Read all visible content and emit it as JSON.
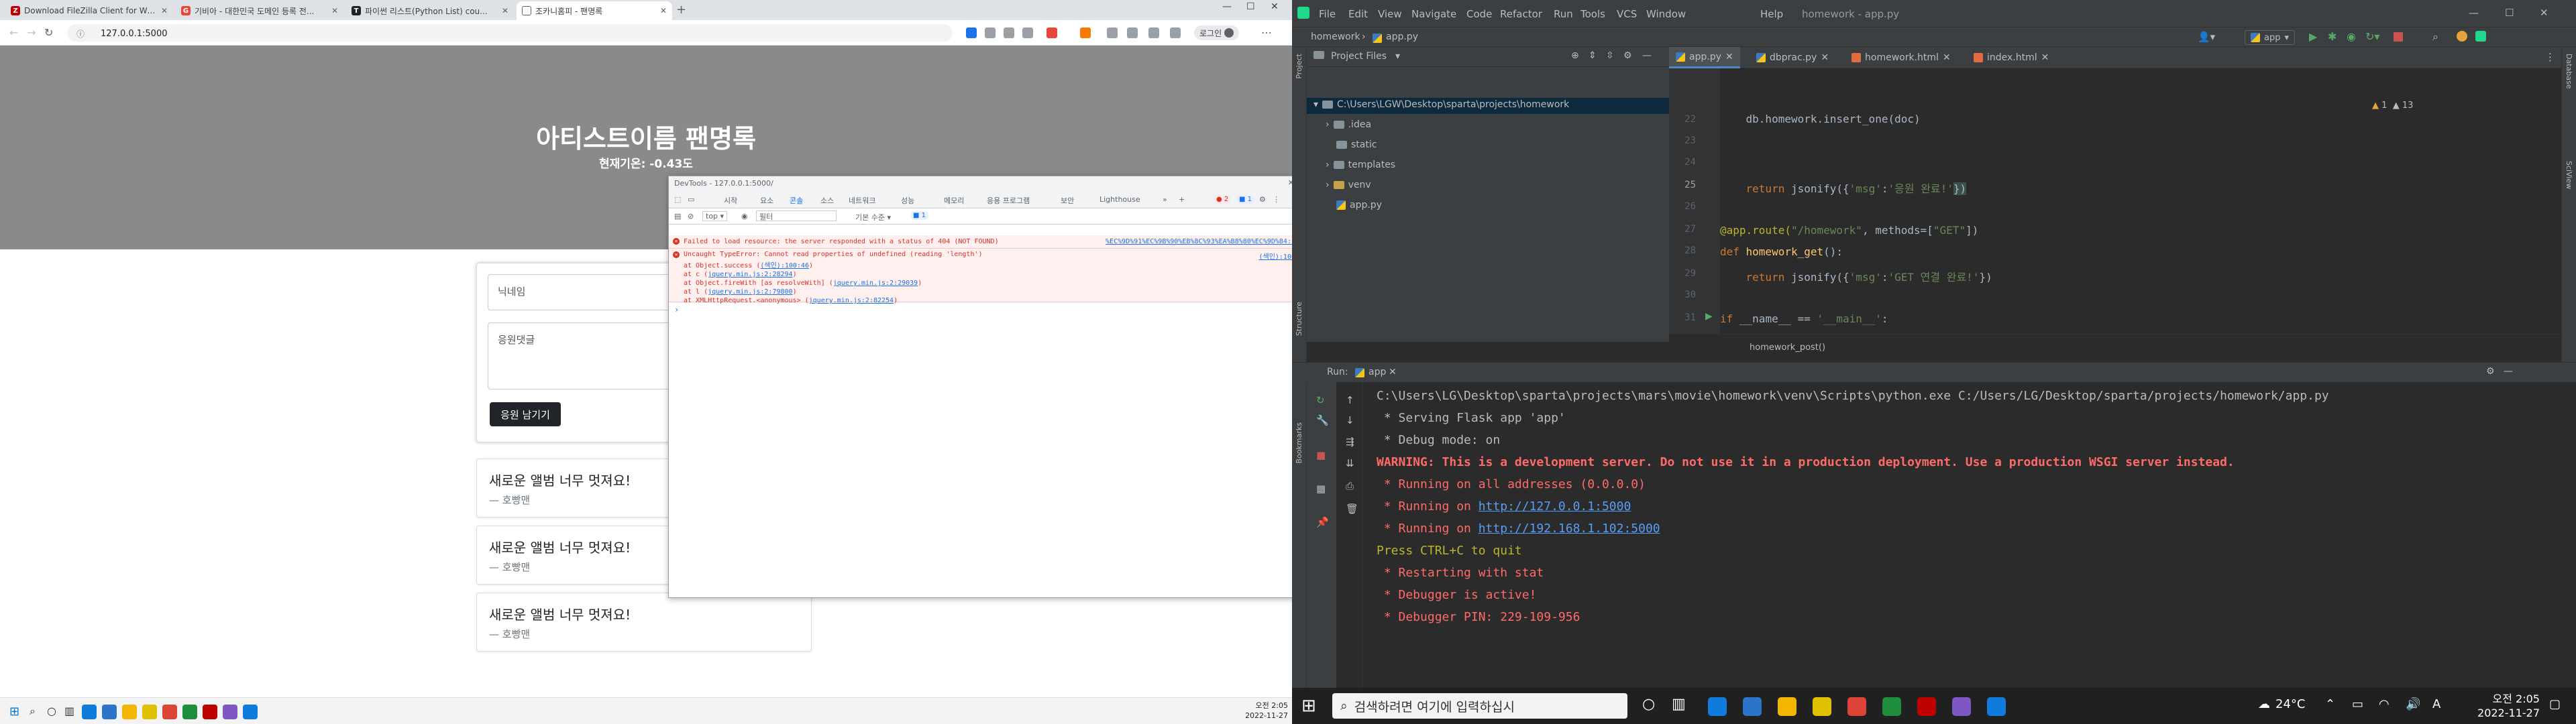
{
  "browser": {
    "tabs": [
      {
        "label": "Download FileZilla Client for Wi...",
        "fav_color": "#bf0000",
        "fav_char": "Z"
      },
      {
        "label": "기비아 - 대한민국 도메인 등록 전...",
        "fav_color": "#e8453c",
        "fav_char": "G"
      },
      {
        "label": "파이썬 리스트(Python List) cou...",
        "fav_color": "#222222",
        "fav_char": "T"
      },
      {
        "label": "조카니홈피 - 팬명록",
        "fav_color": "#5f6368",
        "fav_char": "□"
      }
    ],
    "url": "127.0.0.1:5000",
    "login_label": "로그인"
  },
  "page": {
    "title": "아티스트이름 팬명록",
    "temperature": "현재기온: -0.43도",
    "nickname_placeholder": "닉네임",
    "comment_placeholder": "응원댓글",
    "submit_label": "응원 남기기",
    "comments": [
      {
        "text": "새로운 앨범 너무 멋져요!",
        "author": "— 호빵맨"
      },
      {
        "text": "새로운 앨범 너무 멋져요!",
        "author": "— 호빵맨"
      },
      {
        "text": "새로운 앨범 너무 멋져요!",
        "author": "— 호빵맨"
      }
    ]
  },
  "devtools": {
    "title": "DevTools - 127.0.0.1:5000/",
    "tabs": [
      "시작",
      "요소",
      "콘솔",
      "소스",
      "네트워크",
      "성능",
      "메모리",
      "응용 프로그램",
      "보안",
      "Lighthouse"
    ],
    "active_tab": "콘솔",
    "error_count": "2",
    "info_count": "1",
    "context": "top",
    "filter_placeholder": "필터",
    "level": "기본 수준",
    "errors": [
      {
        "message": "Failed to load resource: the server responded with a status of 404 (NOT FOUND)",
        "source": "%EC%9D%91%EC%9B%90%EB%8C%93%EA%B8%80%EC%9D%84:1"
      },
      {
        "message": "Uncaught TypeError: Cannot read properties of undefined (reading 'length')",
        "source": "(색인):100"
      },
      {
        "message": "    at Object.success (",
        "link": "(색인):100:46",
        "tail": ")"
      },
      {
        "message": "    at c (",
        "link": "jquery.min.js:2:28294",
        "tail": ")"
      },
      {
        "message": "    at Object.fireWith [as resolveWith] (",
        "link": "jquery.min.js:2:29039",
        "tail": ")"
      },
      {
        "message": "    at l (",
        "link": "jquery.min.js:2:79800",
        "tail": ")"
      },
      {
        "message": "    at XMLHttpRequest.<anonymous> (",
        "link": "jquery.min.js:2:82254",
        "tail": ")"
      }
    ]
  },
  "left_taskbar": {
    "time": "오전 2:05",
    "date": "2022-11-27"
  },
  "ide": {
    "menus": [
      "File",
      "Edit",
      "View",
      "Navigate",
      "Code",
      "Refactor",
      "Run",
      "Tools",
      "VCS",
      "Window",
      "Help"
    ],
    "window_title": "homework - app.py",
    "breadcrumb_project": "homework",
    "breadcrumb_file": "app.py",
    "run_config": "app",
    "project_label": "Project Files",
    "tree": {
      "root": "C:\\Users\\LGW\\Desktop\\sparta\\projects\\homework",
      "items": [
        ".idea",
        "static",
        "templates",
        "venv",
        "app.py"
      ]
    },
    "editor_tabs": [
      "app.py",
      "dbprac.py",
      "homework.html",
      "index.html"
    ],
    "inspections": {
      "warnings": "1",
      "weak": "13"
    },
    "lines": [
      "22",
      "23",
      "24",
      "25",
      "26",
      "27",
      "28",
      "29",
      "30",
      "31"
    ],
    "code": {
      "l22": "    db.homework.insert_one(doc)",
      "l25_kw": "    return ",
      "l25_fn": "jsonify",
      "l25_open": "({",
      "l25_s1": "'msg'",
      "l25_colon": ":",
      "l25_s2": "'응원 완료!'",
      "l25_close": "})",
      "l27_dec": "@app.route(",
      "l27_s1": "\"/homework\"",
      "l27_mid": ", methods=[",
      "l27_s2": "\"GET\"",
      "l27_end": "])",
      "l28_kw": "def ",
      "l28_fn": "homework_get",
      "l28_end": "():",
      "l29_kw": "    return ",
      "l29_mid": "jsonify({",
      "l29_s1": "'msg'",
      "l29_colon": ":",
      "l29_s2": "'GET 연결 완료!'",
      "l29_end": "})",
      "l31_kw": "if ",
      "l31_mid": "__name__ == ",
      "l31_s": "'__main__'",
      "l31_end": ":"
    },
    "code_breadcrumb": "homework_post()",
    "run_label": "Run:",
    "run_tab": "app",
    "console": [
      {
        "cls": "o-norm",
        "text": "C:\\Users\\LG\\Desktop\\sparta\\projects\\mars\\movie\\homework\\venv\\Scripts\\python.exe C:/Users/LG/Desktop/sparta/projects/homework/app.py"
      },
      {
        "cls": "o-norm",
        "text": " * Serving Flask app 'app'"
      },
      {
        "cls": "o-norm",
        "text": " * Debug mode: on"
      },
      {
        "cls": "o-warn",
        "text": "WARNING: This is a development server. Do not use it in a production deployment. Use a production WSGI server instead."
      },
      {
        "cls": "o-err",
        "text": " * Running on all addresses (0.0.0.0)"
      },
      {
        "cls": "o-err",
        "text": " * Running on ",
        "link": "http://127.0.0.1:5000"
      },
      {
        "cls": "o-err",
        "text": " * Running on ",
        "link": "http://192.168.1.102:5000"
      },
      {
        "cls": "o-yel",
        "text": "Press CTRL+C to quit"
      },
      {
        "cls": "o-err",
        "text": " * Restarting with stat"
      },
      {
        "cls": "o-err",
        "text": " * Debugger is active!"
      },
      {
        "cls": "o-err",
        "text": " * Debugger PIN: 229-109-956"
      }
    ]
  },
  "right_taskbar": {
    "search_placeholder": "검색하려면 여기에 입력하십시",
    "temp": "24°C",
    "time": "오전 2:05",
    "date": "2022-11-27"
  }
}
